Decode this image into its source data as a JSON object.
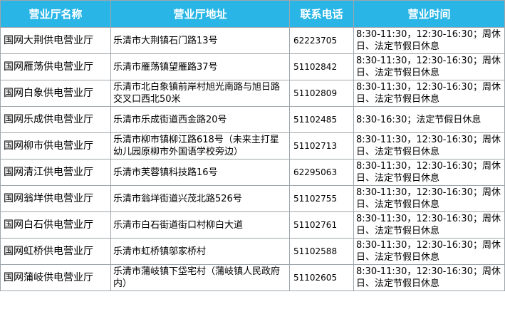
{
  "table": {
    "headers": [
      "营业厅名称",
      "营业厅地址",
      "联系电话",
      "营业时间"
    ],
    "rows": [
      {
        "name": "国网大荆供电营业厅",
        "address": "乐清市大荆镇石门路13号",
        "phone": "62223705",
        "hours": "8:30-11:30，12:30-16:30；周休日、法定节假日休息"
      },
      {
        "name": "国网雁荡供电营业厅",
        "address": "乐清市雁荡镇望雁路37号",
        "phone": "51102842",
        "hours": "8:30-11:30，12:30-16:30；周休日、法定节假日休息"
      },
      {
        "name": "国网白象供电营业厅",
        "address": "乐清市北白象镇前岸村旭光南路与旭日路交叉口西北50米",
        "phone": "51102809",
        "hours": "8:30-11:30，12:30-16:30；周休日、法定节假日休息"
      },
      {
        "name": "国网乐成供电营业厅",
        "address": "乐清市乐成街道西金路20号",
        "phone": "51102485",
        "hours": "8:30-16:30；法定节假日休息"
      },
      {
        "name": "国网柳市供电营业厅",
        "address": "乐清市柳市镇柳江路618号（未来主打星幼儿园原柳市外国语学校旁边）",
        "phone": "51102713",
        "hours": "8:30-11:30，12:30-16:30；周休日、法定节假日休息"
      },
      {
        "name": "国网清江供电营业厅",
        "address": "乐清市芙蓉镇科技路16号",
        "phone": "62295063",
        "hours": "8:30-11:30，12:30-16:30；周休日、法定节假日休息"
      },
      {
        "name": "国网翁垟供电营业厅",
        "address": "乐清市翁垟街道兴茂北路526号",
        "phone": "51102755",
        "hours": "8:30-11:30，12:30-16:30；周休日、法定节假日休息"
      },
      {
        "name": "国网白石供电营业厅",
        "address": "乐清市白石街道街口村柳白大道",
        "phone": "51102761",
        "hours": "8:30-11:30，12:30-16:30；周休日、法定节假日休息"
      },
      {
        "name": "国网虹桥供电营业厅",
        "address": "乐清市虹桥镇邬家桥村",
        "phone": "51102588",
        "hours": "8:30-11:30，12:30-16:30；周休日、法定节假日休息"
      },
      {
        "name": "国网蒲岐供电营业厅",
        "address": "乐清市蒲岐镇下垈宅村（蒲岐镇人民政府内）",
        "phone": "51102605",
        "hours": "8:30-11:30，12:30-16:30；周休日、法定节假日休息"
      }
    ]
  },
  "colors": {
    "header_bg": "#29b6e6",
    "header_text": "#ffffff",
    "border": "#9fa6ab"
  }
}
